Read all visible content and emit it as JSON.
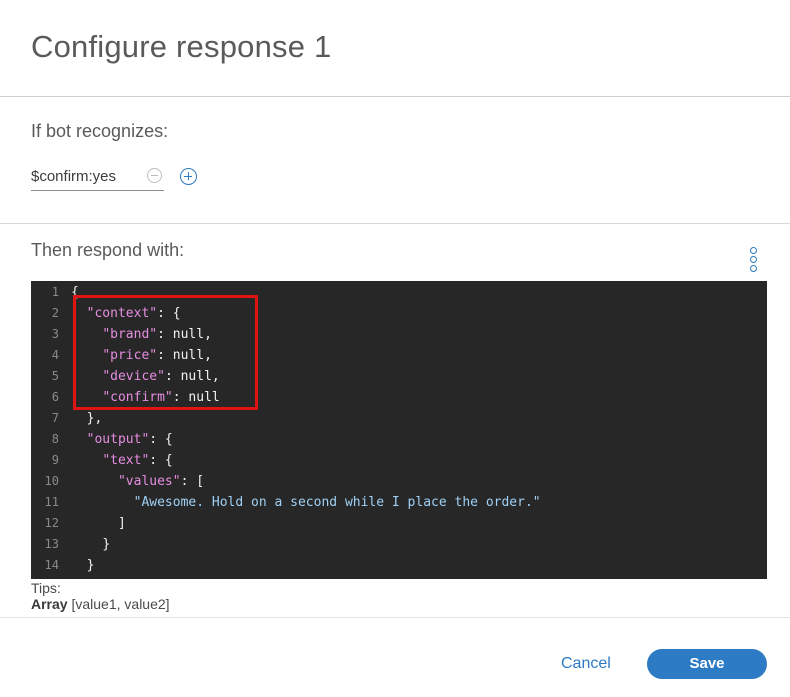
{
  "header": {
    "title": "Configure response 1"
  },
  "condition": {
    "label": "If bot recognizes:",
    "value": "$confirm:yes"
  },
  "response": {
    "label": "Then respond with:",
    "code_lines": [
      {
        "n": "1"
      },
      {
        "n": "2"
      },
      {
        "n": "3"
      },
      {
        "n": "4"
      },
      {
        "n": "5"
      },
      {
        "n": "6"
      },
      {
        "n": "7"
      },
      {
        "n": "8"
      },
      {
        "n": "9"
      },
      {
        "n": "10"
      },
      {
        "n": "11"
      },
      {
        "n": "12"
      },
      {
        "n": "13"
      },
      {
        "n": "14"
      }
    ],
    "code": {
      "l1": "{",
      "l2_key": "\"context\"",
      "l2_rest": ": {",
      "l3_key": "\"brand\"",
      "l3_rest": ": null,",
      "l4_key": "\"price\"",
      "l4_rest": ": null,",
      "l5_key": "\"device\"",
      "l5_rest": ": null,",
      "l6_key": "\"confirm\"",
      "l6_rest": ": null",
      "l7": "},",
      "l8_key": "\"output\"",
      "l8_rest": ": {",
      "l9_key": "\"text\"",
      "l9_rest": ": {",
      "l10_key": "\"values\"",
      "l10_rest": ": [",
      "l11_str": "\"Awesome. Hold on a second while I place the order.\"",
      "l12": "]",
      "l13": "}",
      "l14": "}"
    }
  },
  "tips": {
    "title": "Tips:",
    "array_label": "Array",
    "array_value": " [value1, value2]"
  },
  "footer": {
    "cancel_label": "Cancel",
    "save_label": "Save"
  },
  "colors": {
    "accent": "#2d7bc4",
    "highlight": "#e11414",
    "editor_bg": "#272727"
  }
}
